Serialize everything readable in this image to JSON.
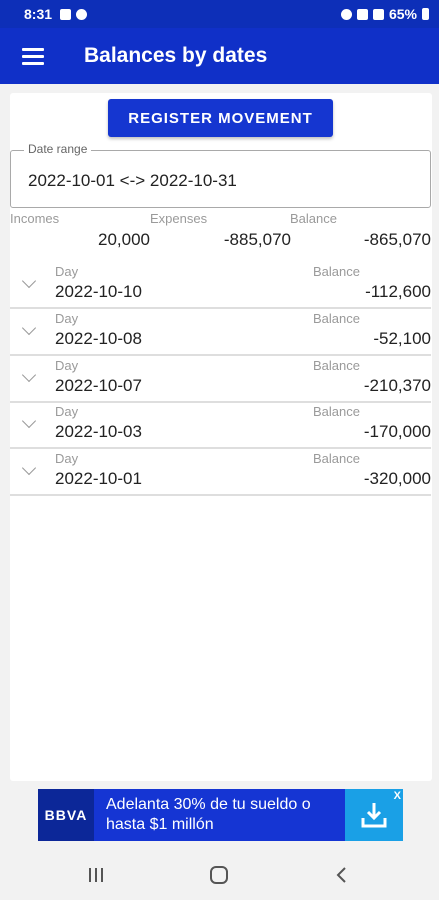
{
  "status_bar": {
    "time": "8:31",
    "battery": "65%"
  },
  "app_bar": {
    "title": "Balances by dates",
    "menu_icon": "hamburger-menu-icon"
  },
  "register_button": {
    "label": "REGISTER MOVEMENT"
  },
  "date_range": {
    "label": "Date range",
    "value": "2022-10-01 <-> 2022-10-31"
  },
  "summary": {
    "incomes_label": "Incomes",
    "incomes_value": "20,000",
    "expenses_label": "Expenses",
    "expenses_value": "-885,070",
    "balance_label": "Balance",
    "balance_value": "-865,070"
  },
  "days": [
    {
      "day_label": "Day",
      "day": "2022-10-10",
      "balance_label": "Balance",
      "balance": "-112,600"
    },
    {
      "day_label": "Day",
      "day": "2022-10-08",
      "balance_label": "Balance",
      "balance": "-52,100"
    },
    {
      "day_label": "Day",
      "day": "2022-10-07",
      "balance_label": "Balance",
      "balance": "-210,370"
    },
    {
      "day_label": "Day",
      "day": "2022-10-03",
      "balance_label": "Balance",
      "balance": "-170,000"
    },
    {
      "day_label": "Day",
      "day": "2022-10-01",
      "balance_label": "Balance",
      "balance": "-320,000"
    }
  ],
  "ad": {
    "brand": "BBVA",
    "text": "Adelanta 30% de tu sueldo o hasta $1 millón",
    "close": "X"
  },
  "colors": {
    "primary": "#1030c8",
    "button": "#1536d0",
    "ad_download": "#1aa0e6"
  }
}
